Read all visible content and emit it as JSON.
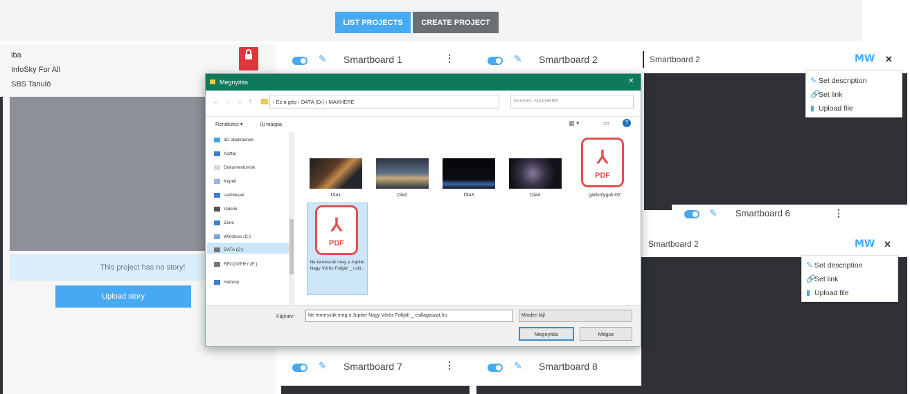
{
  "topnav": {
    "list_projects": "LIST PROJECTS",
    "create_project": "CREATE PROJECT"
  },
  "project": {
    "line1": "iba",
    "line2": "InfoSky For All",
    "line3": "SBS Tanuló",
    "no_story": "This project has no story!",
    "upload_story": "Upload story"
  },
  "smartboards": {
    "sb1": "Smartboard 1",
    "sb2": "Smartboard 2",
    "sb6": "Smartboard 6",
    "sb7": "Smartboard 7",
    "sb8": "Smartboard 8"
  },
  "overlays": {
    "top_title": "Smartboard 2",
    "bottom_title": "Smartboard 2",
    "mw_label": "MW",
    "menu": [
      "Set description",
      "Set link",
      "Upload file"
    ]
  },
  "dialog": {
    "title": "Megnyitás",
    "address": "› Ez a gép › DATA (D:) › MAXHERE",
    "search_placeholder": "Keresés: MAXHERE",
    "organize": "Rendezés ▾",
    "new_folder": "Új mappa",
    "nav_items": [
      "3D objektumok",
      "Asztal",
      "Dokumentumok",
      "Képek",
      "Letöltések",
      "Videók",
      "Zene",
      "Windows (C:)",
      "DATA (D:)",
      "RECOVERY (E:)",
      "Hálózat"
    ],
    "files": [
      "Dia1",
      "Dia2",
      "Dia3",
      "Dia4",
      "gadsolygok-02"
    ],
    "selected_file_label": "Ne temessük meg a Jupiter Nagy Vörös Foltját! _ csill...",
    "pdf_label": "PDF",
    "filename_label": "Fájlnév:",
    "filename_value": "Ne temessük meg a Jupiter Nagy Vörös Foltját! _ csillagaszat.hu",
    "filetype": "Minden fájl",
    "open": "Megnyitás",
    "cancel": "Mégse"
  },
  "colors": {
    "accent": "#47a9f2",
    "dark_panel": "#2f3136",
    "dialog_title": "#0f7a5a",
    "lock_red": "#e0373c"
  }
}
